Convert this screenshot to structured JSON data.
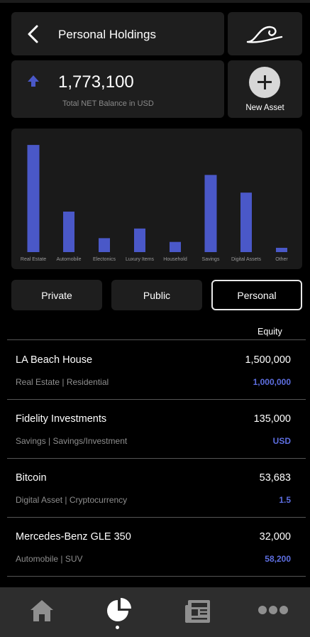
{
  "header": {
    "title": "Personal Holdings"
  },
  "balance": {
    "value": "1,773,100",
    "label": "Total NET Balance in USD"
  },
  "new_asset": {
    "label": "New Asset"
  },
  "accent": "#4a58c8",
  "chart_data": {
    "type": "bar",
    "categories": [
      "Real Estate",
      "Automobile",
      "Electonics",
      "Luxury Items",
      "Household",
      "Savings",
      "Digital Assets",
      "Other"
    ],
    "values": [
      1000000,
      378000,
      130000,
      220000,
      95000,
      720000,
      555000,
      40000
    ],
    "ylim": [
      0,
      1100000
    ],
    "grid": false,
    "legend": "none"
  },
  "tabs": [
    {
      "label": "Private",
      "active": false
    },
    {
      "label": "Public",
      "active": false
    },
    {
      "label": "Personal",
      "active": true
    }
  ],
  "list": {
    "column_header": "Equity",
    "rows": [
      {
        "name": "LA Beach House",
        "category": "Real Estate  | Residential",
        "amount": "1,500,000",
        "equity": "1,000,000"
      },
      {
        "name": "Fidelity Investments",
        "category": "Savings  |  Savings/Investment",
        "amount": "135,000",
        "equity": "USD"
      },
      {
        "name": "Bitcoin",
        "category": "Digital Asset  |  Cryptocurrency",
        "amount": "53,683",
        "equity": "1.5"
      },
      {
        "name": "Mercedes-Benz GLE 350",
        "category": "Automobile  |  SUV",
        "amount": "32,000",
        "equity": "58,200"
      }
    ]
  },
  "nav": {
    "items": [
      {
        "icon": "home-icon"
      },
      {
        "icon": "pie-chart-icon",
        "active": true
      },
      {
        "icon": "newspaper-icon"
      },
      {
        "icon": "more-icon"
      }
    ]
  }
}
